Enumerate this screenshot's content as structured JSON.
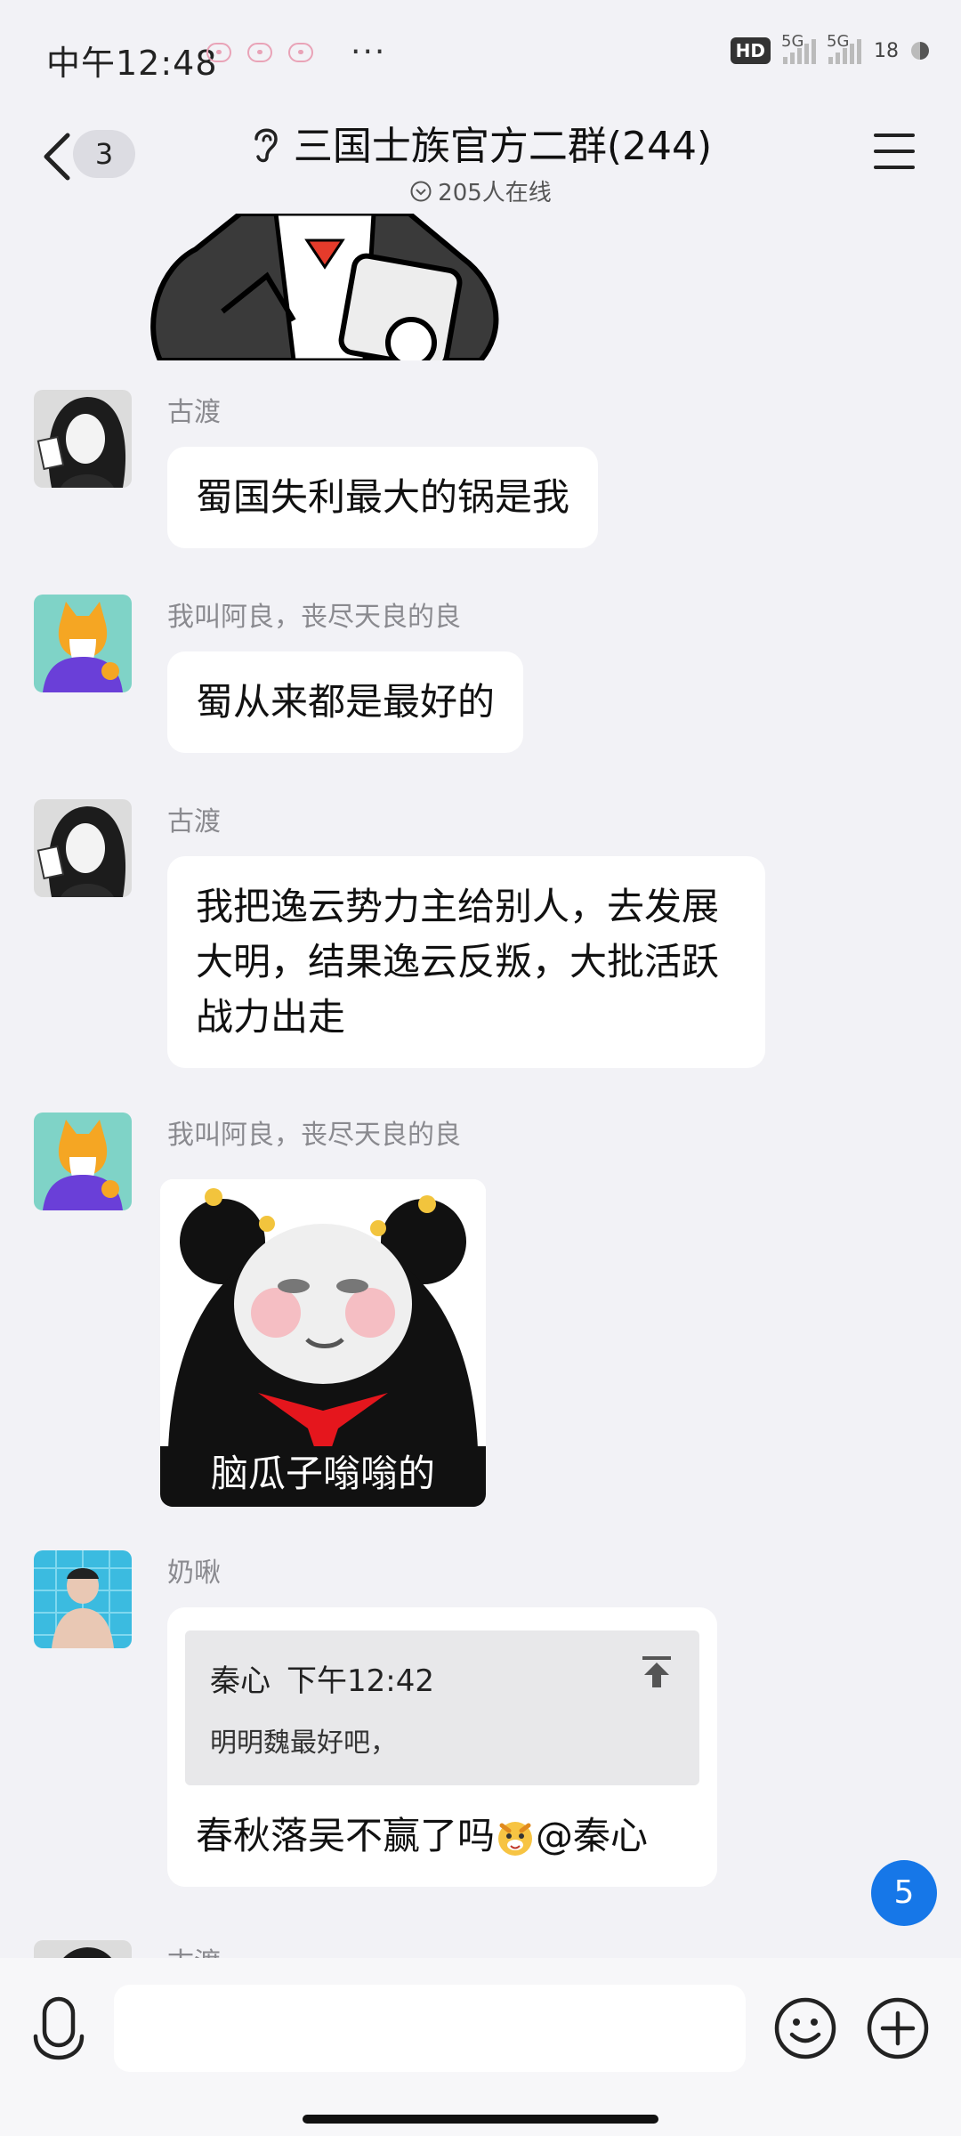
{
  "status_bar": {
    "time": "中午12:48",
    "more": "···",
    "hd": "HD",
    "signal1": "5G",
    "signal2": "5G",
    "battery": "18"
  },
  "header": {
    "unread_count": "3",
    "title": "三国士族官方二群(244)",
    "online": "205人在线"
  },
  "messages": [
    {
      "sender": "古渡",
      "text": "蜀国失利最大的锅是我"
    },
    {
      "sender": "我叫阿良，丧尽天良的良",
      "text": "蜀从来都是最好的"
    },
    {
      "sender": "古渡",
      "text": "我把逸云势力主给别人，去发展大明，结果逸云反叛，大批活跃战力出走"
    },
    {
      "sender": "我叫阿良，丧尽天良的良",
      "sticker_caption": "脑瓜子嗡嗡的"
    },
    {
      "sender": "奶啾",
      "quote_author": "秦心",
      "quote_time": "下午12:42",
      "quote_text": "明明魏最好吧，",
      "text": "春秋落吴不赢了吗",
      "mention": "@秦心"
    },
    {
      "sender": "古渡"
    }
  ],
  "new_message_count": "5",
  "input": {
    "placeholder": ""
  },
  "colors": {
    "accent": "#1677e8",
    "background": "#f2f2f6",
    "bubble": "#ffffff"
  }
}
